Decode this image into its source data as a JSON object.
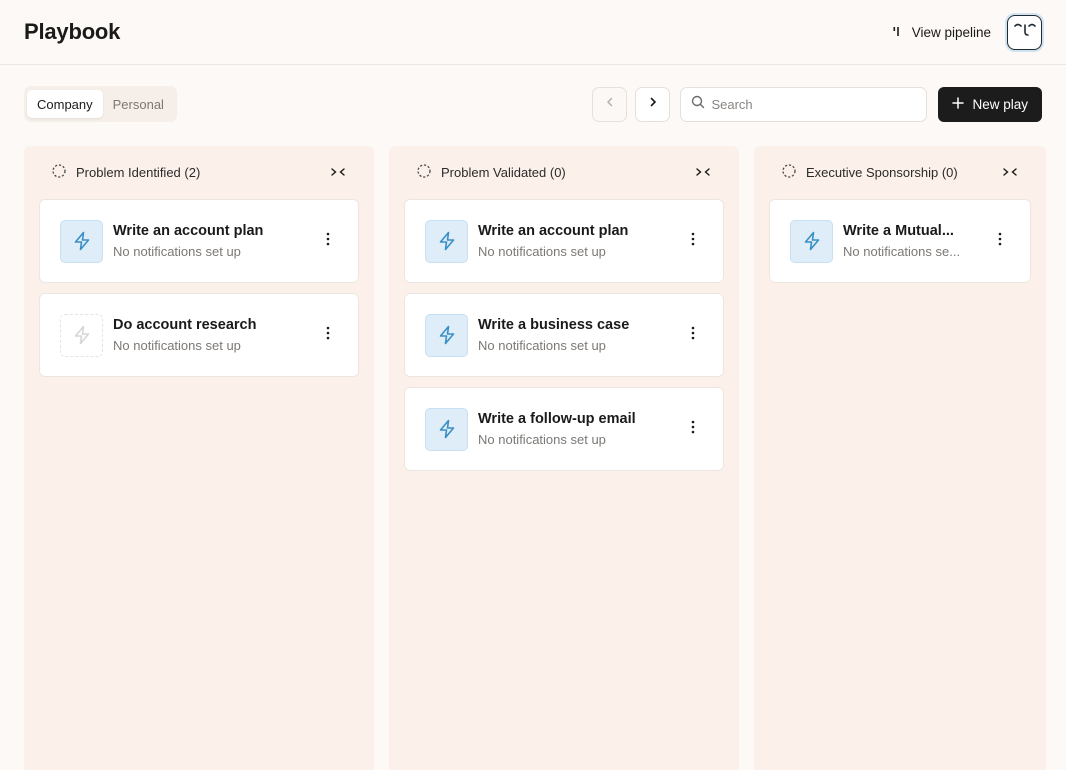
{
  "header": {
    "title": "Playbook",
    "view_pipeline_label": "View pipeline",
    "avatar_icon": "smile-face-icon"
  },
  "toolbar": {
    "tabs": [
      {
        "label": "Company",
        "active": true
      },
      {
        "label": "Personal",
        "active": false
      }
    ],
    "search_placeholder": "Search",
    "new_play_label": "New play"
  },
  "columns": [
    {
      "title": "Problem Identified (2)",
      "cards": [
        {
          "title": "Write an account plan",
          "subtitle": "No notifications set up",
          "icon": "lightning-icon",
          "muted": false
        },
        {
          "title": "Do account research",
          "subtitle": "No notifications set up",
          "icon": "lightning-icon",
          "muted": true
        }
      ]
    },
    {
      "title": "Problem Validated (0)",
      "cards": [
        {
          "title": "Write an account plan",
          "subtitle": "No notifications set up",
          "icon": "lightning-icon",
          "muted": false
        },
        {
          "title": "Write a business case",
          "subtitle": "No notifications set up",
          "icon": "lightning-icon",
          "muted": false
        },
        {
          "title": "Write a follow-up email",
          "subtitle": "No notifications set up",
          "icon": "lightning-icon",
          "muted": false
        }
      ]
    },
    {
      "title": "Executive Sponsorship (0)",
      "cards": [
        {
          "title": "Write a Mutual...",
          "subtitle": "No notifications se...",
          "icon": "lightning-icon",
          "muted": false
        }
      ]
    }
  ],
  "colors": {
    "accent_icon": "#3a8fc4",
    "icon_bg": "#deedf8",
    "column_bg": "#fcf1ea",
    "primary_button": "#1c1c1c"
  }
}
